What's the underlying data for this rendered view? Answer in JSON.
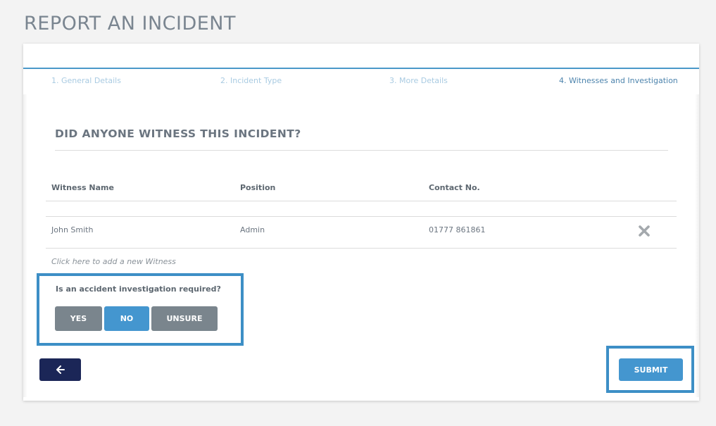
{
  "page": {
    "title": "REPORT AN INCIDENT"
  },
  "steps": [
    {
      "label": "1. General Details"
    },
    {
      "label": "2. Incident Type"
    },
    {
      "label": "3. More Details"
    },
    {
      "label": "4. Witnesses and Investigation",
      "active": true
    }
  ],
  "witness_section": {
    "title": "DID ANYONE WITNESS THIS INCIDENT?",
    "columns": [
      "Witness Name",
      "Position",
      "Contact No."
    ],
    "rows": [
      {
        "name": "John Smith",
        "position": "Admin",
        "contact": "01777 861861",
        "remove_icon": "close-x-icon"
      }
    ],
    "add_link": "Click here to add a new Witness"
  },
  "investigation": {
    "question": "Is an accident investigation required?",
    "options": [
      "YES",
      "NO",
      "UNSURE"
    ],
    "selected": "NO"
  },
  "actions": {
    "back_icon": "arrow-left-icon",
    "submit_label": "SUBMIT"
  },
  "colors": {
    "accent": "#4496cf",
    "highlight_border": "#3d8fc6",
    "back_button": "#1b2657",
    "unselected_option": "#7a858d"
  }
}
